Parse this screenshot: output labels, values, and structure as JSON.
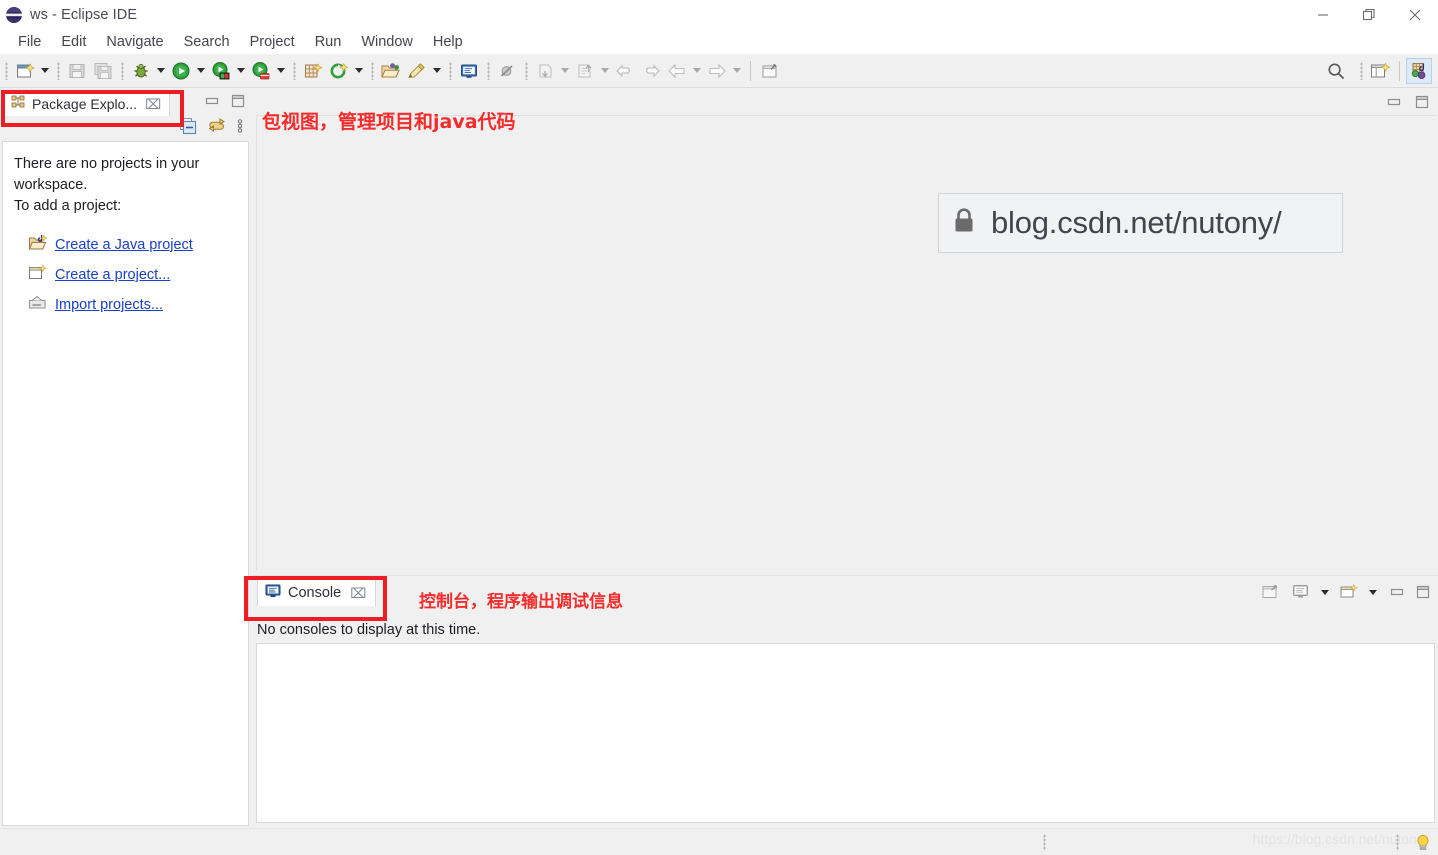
{
  "window": {
    "title": "ws - Eclipse IDE",
    "app_icon": "eclipse-logo-icon",
    "controls": {
      "minimize": "minimize-button",
      "restore": "restore-button",
      "close": "close-button"
    }
  },
  "menubar": {
    "items": [
      {
        "label": "File"
      },
      {
        "label": "Edit"
      },
      {
        "label": "Navigate"
      },
      {
        "label": "Search"
      },
      {
        "label": "Project"
      },
      {
        "label": "Run"
      },
      {
        "label": "Window"
      },
      {
        "label": "Help"
      }
    ]
  },
  "toolbar": {
    "groups": [
      {
        "buttons": [
          {
            "icon": "new-wizard-icon",
            "dropdown": true
          }
        ]
      },
      {
        "buttons": [
          {
            "icon": "save-icon",
            "dropdown": false,
            "disabled": true
          },
          {
            "icon": "save-all-icon",
            "dropdown": false,
            "disabled": true
          }
        ]
      },
      {
        "buttons": [
          {
            "icon": "debug-icon",
            "dropdown": true
          },
          {
            "icon": "run-icon",
            "dropdown": true
          },
          {
            "icon": "run-external-tools-icon",
            "dropdown": true
          },
          {
            "icon": "coverage-icon",
            "dropdown": true
          }
        ]
      },
      {
        "buttons": [
          {
            "icon": "new-java-package-icon",
            "dropdown": false
          },
          {
            "icon": "new-java-class-icon",
            "dropdown": true
          }
        ]
      },
      {
        "buttons": [
          {
            "icon": "open-type-icon",
            "dropdown": false
          },
          {
            "icon": "open-task-icon",
            "dropdown": true
          }
        ]
      },
      {
        "buttons": [
          {
            "icon": "toggle-mark-occurrences-icon",
            "dropdown": false
          }
        ]
      },
      {
        "buttons": [
          {
            "icon": "skip-all-breakpoints-icon",
            "dropdown": false
          }
        ]
      },
      {
        "buttons": [
          {
            "icon": "previous-annotation-icon",
            "dropdown": true,
            "disabled": true
          },
          {
            "icon": "next-annotation-icon",
            "dropdown": true,
            "disabled": true
          },
          {
            "icon": "back-icon",
            "dropdown": false,
            "disabled": true
          },
          {
            "icon": "forward-icon",
            "dropdown": false,
            "disabled": true
          },
          {
            "icon": "back-nav-icon",
            "dropdown": true,
            "disabled": true
          },
          {
            "icon": "forward-nav-icon",
            "dropdown": true,
            "disabled": true
          }
        ]
      },
      {
        "buttons": [
          {
            "icon": "pin-editor-icon",
            "dropdown": false
          }
        ]
      }
    ],
    "right": {
      "search": "search-icon",
      "open-perspective": "open-perspective-icon",
      "perspective-java": "java-perspective-icon"
    }
  },
  "package_explorer": {
    "tab_label": "Package Explo...",
    "tab_icon": "package-explorer-icon",
    "close_glyph": "⌧",
    "view_buttons": {
      "collapse_all": "collapse-all-icon",
      "link_with_editor": "link-with-editor-icon",
      "view_menu": "view-menu-icon",
      "minimize": "minimize-view-icon",
      "maximize": "maximize-view-icon"
    },
    "empty_message_line1": "There are no projects in your",
    "empty_message_line2": "workspace.",
    "empty_message_line3": "To add a project:",
    "links": [
      {
        "label": "Create a Java project",
        "icon": "new-java-project-icon"
      },
      {
        "label": "Create a project...",
        "icon": "new-project-icon"
      },
      {
        "label": "Import projects...",
        "icon": "import-projects-icon"
      }
    ]
  },
  "editor": {
    "annotation": "包视图，管理项目和java代码",
    "minimize": "minimize-editor-icon",
    "maximize": "maximize-editor-icon"
  },
  "url_watermark": {
    "lock_icon": "lock-icon",
    "text": "blog.csdn.net/nutony/"
  },
  "console": {
    "tab_label": "Console",
    "tab_icon": "console-icon",
    "close_glyph": "⌧",
    "annotation": "控制台，程序输出调试信息",
    "status_text": "No consoles to display at this time.",
    "toolbar": {
      "open_console": "open-console-icon",
      "display_selected_console": "display-selected-console-icon",
      "display_selected_console_dropdown": "chevron-down-icon",
      "new_console_view": "new-console-view-icon",
      "new_console_view_dropdown": "chevron-down-icon",
      "minimize": "minimize-view-icon",
      "maximize": "maximize-view-icon"
    }
  },
  "statusbar": {
    "watermark": "https://blog.csdn.net/nutony",
    "tip_icon": "tip-of-the-day-icon"
  },
  "annotations": {
    "box_color": "#ee1c25",
    "note_color": "#f42c2c"
  }
}
